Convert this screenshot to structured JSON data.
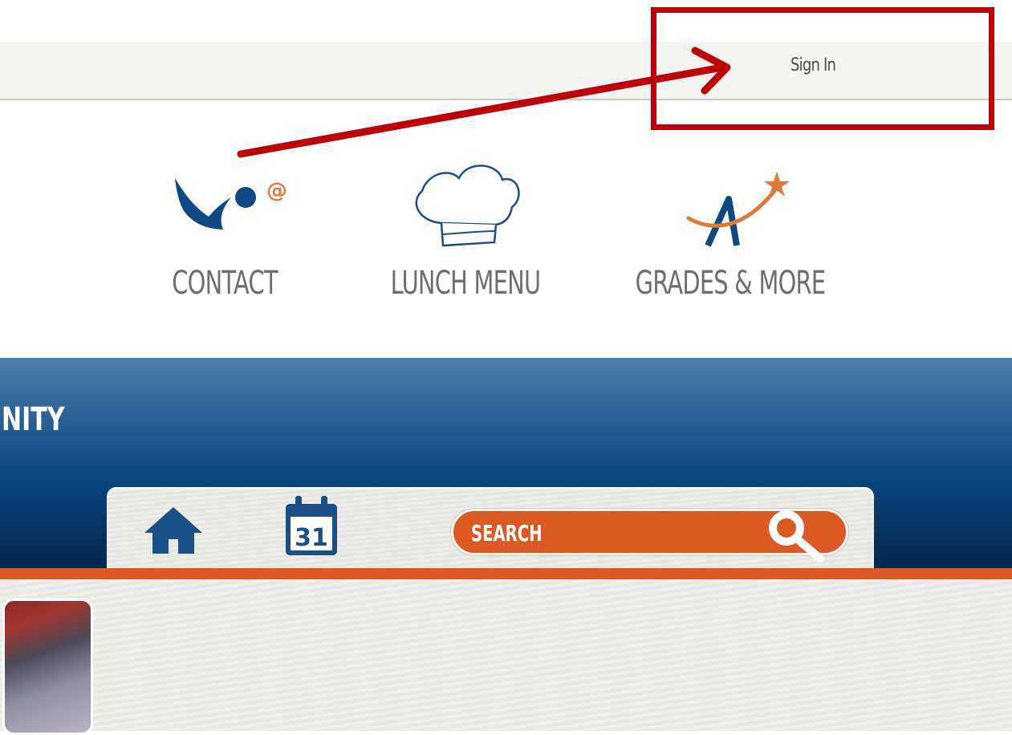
{
  "header": {
    "signin_label": "Sign In"
  },
  "quick_links": {
    "contact": {
      "label": "CONTACT",
      "icon": "contact-person-icon"
    },
    "lunch": {
      "label": "LUNCH MENU",
      "icon": "chef-hat-icon"
    },
    "grades": {
      "label": "GRADES & MORE",
      "icon": "grades-a-star-icon"
    }
  },
  "banner": {
    "text": "NITY"
  },
  "toolbar": {
    "home_icon": "home-icon",
    "calendar_icon": "calendar-icon",
    "calendar_day": "31",
    "search_placeholder": "SEARCH",
    "search_icon": "magnifier-icon"
  },
  "colors": {
    "accent_orange": "#db5a23",
    "banner_blue": "#0a437d",
    "annotation_red": "#c00008"
  }
}
